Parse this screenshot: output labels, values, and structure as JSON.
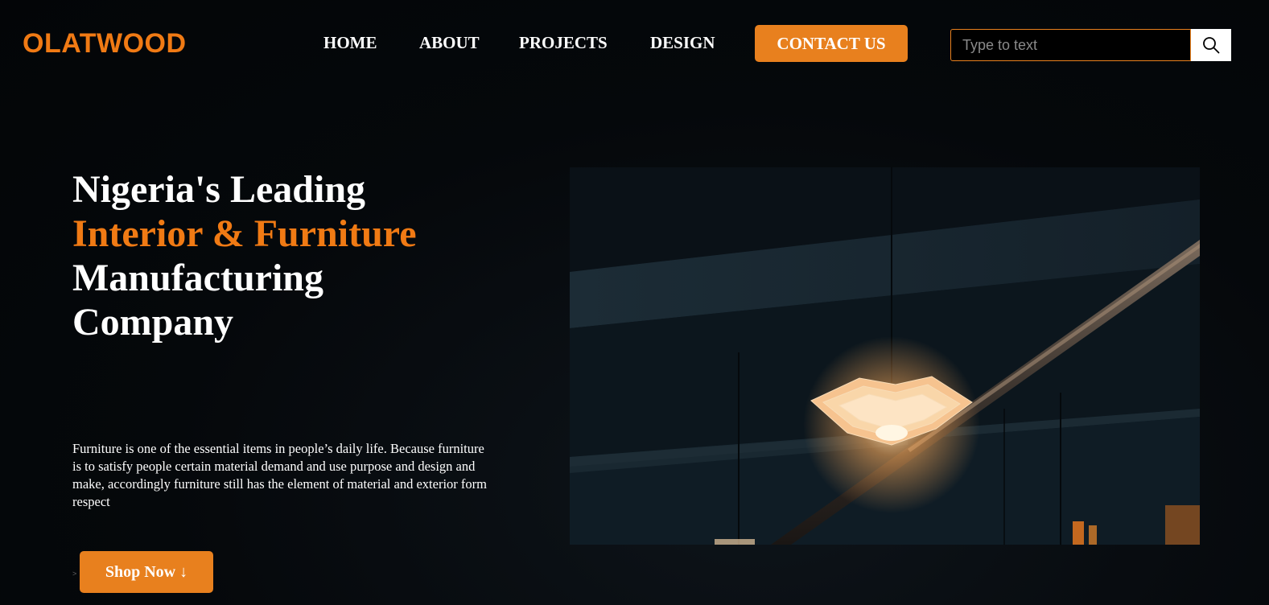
{
  "brand": {
    "name": "OLATWOOD",
    "accent_color": "#f07a14"
  },
  "nav": {
    "items": [
      "HOME",
      "ABOUT",
      "PROJECTS",
      "DESIGN"
    ],
    "contact_label": "CONTACT US"
  },
  "search": {
    "placeholder": "Type to text",
    "icon": "search-icon"
  },
  "hero": {
    "title_line1": "Nigeria's Leading",
    "title_line2": "Interior & Furniture",
    "title_line3": "Manufacturing",
    "title_line4": "Company",
    "description": "Furniture is one of the essential items in people’s daily life. Because furniture is to satisfy people certain material demand and use purpose and design and make, accordingly furniture still has the element of material and exterior form respect",
    "cta_label": "Shop Now ↓"
  },
  "colors": {
    "button": "#e8801e",
    "background": "#05080b"
  }
}
